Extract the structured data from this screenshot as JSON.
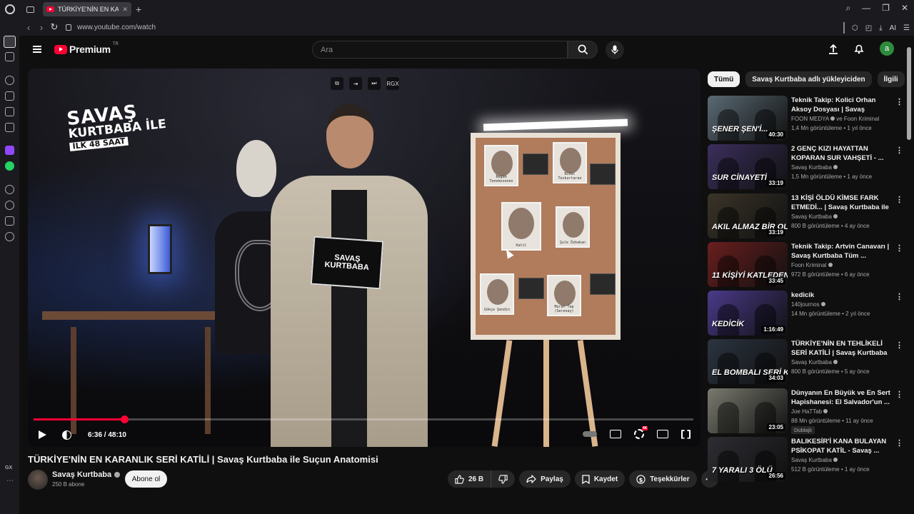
{
  "browser": {
    "tab_title": "TÜRKİYE'NİN EN KARANLIK",
    "url": "www.youtube.com/watch",
    "ai_label": "AI",
    "gx_label": "GX"
  },
  "masthead": {
    "brand": "Premium",
    "tm": "TR",
    "search_placeholder": "Ara",
    "avatar_letter": "a"
  },
  "player": {
    "overlay_logo": {
      "line1": "SAVAŞ",
      "line2": "KURTBABA İLE",
      "line3": "İLK 48 SAAT"
    },
    "card_text": "SAVAŞ KURTBABA",
    "board_labels": [
      "Begüm Tenekesenen",
      "Nihal Teskurtaran",
      "Katil",
      "Şule Özbakan",
      "Gökçe Şendin",
      "Murat Tap (Serenay)"
    ],
    "top_controls": [
      "⧉",
      "⇥",
      "⏭",
      "RGX"
    ],
    "current_time": "6:36",
    "duration": "48:10",
    "progress_fraction": 0.137
  },
  "video": {
    "title": "TÜRKİYE'NİN EN KARANLIK SERİ KATİLİ | Savaş Kurtbaba ile Suçun Anatomisi",
    "channel": "Savaş Kurtbaba",
    "subscribers": "250 B abone",
    "subscribe_label": "Abone ol",
    "likes": "26 B",
    "share_label": "Paylaş",
    "save_label": "Kaydet",
    "thanks_label": "Teşekkürler",
    "more_label": "⋯"
  },
  "chips": [
    "Tümü",
    "Savaş Kurtbaba adlı yükleyiciden",
    "İlgili"
  ],
  "recommendations": [
    {
      "title": "Teknik Takip: Kolici Orhan Aksoy Dosyası | Savaş Kurtba...",
      "channel": "FOON MEDYA",
      "channel_extra": "ve Foon Kriminal",
      "meta": "1,4 Mn görüntüleme • 1 yıl önce",
      "duration": "40:30",
      "thumb_text": "ŞENER ŞEN'İ...",
      "color": "#5a6a74"
    },
    {
      "title": "2 GENÇ KIZI HAYATTAN KOPARAN SUR VAHŞETİ - ...",
      "channel": "Savaş Kurtbaba",
      "channel_extra": "",
      "meta": "1,5 Mn görüntüleme • 1 ay önce",
      "duration": "33:19",
      "thumb_text": "SUR CİNAYETİ",
      "color": "#3b2f5c"
    },
    {
      "title": "13 KİŞİ ÖLDÜ KİMSE FARK ETMEDİ... | Savaş Kurtbaba ile ...",
      "channel": "Savaş Kurtbaba",
      "channel_extra": "",
      "meta": "800 B görüntüleme • 4 ay önce",
      "duration": "33:19",
      "thumb_text": "AKIL ALMAZ BİR OLAY",
      "color": "#3a3428"
    },
    {
      "title": "Teknik Takip: Artvin Canavarı | Savaş Kurtbaba Tüm ...",
      "channel": "Foon Kriminal",
      "channel_extra": "",
      "meta": "972 B görüntüleme • 6 ay önce",
      "duration": "33:45",
      "thumb_text": "11 KİŞİYİ KATLEDEN",
      "color": "#6a1e1e"
    },
    {
      "title": "kedicik",
      "channel": "140journos",
      "channel_extra": "",
      "meta": "14 Mn görüntüleme • 2 yıl önce",
      "duration": "1:16:49",
      "thumb_text": "KEDİCİK",
      "color": "#4b3a8a",
      "single": true
    },
    {
      "title": "TÜRKİYE'NİN EN TEHLİKELİ SERİ KATİLİ | Savaş Kurtbaba i...",
      "channel": "Savaş Kurtbaba",
      "channel_extra": "",
      "meta": "800 B görüntüleme • 5 ay önce",
      "duration": "34:03",
      "thumb_text": "EL BOMBALI SERİ K...",
      "color": "#2b3440"
    },
    {
      "title": "Dünyanın En Büyük ve En Sert Hapishanesi: El Salvador'un ...",
      "channel": "Joe HaTTab",
      "channel_extra": "",
      "meta": "88 Mn görüntüleme • 11 ay önce",
      "duration": "23:05",
      "thumb_text": "",
      "color": "#7a7a70",
      "badge": "Dublajlı"
    },
    {
      "title": "BALIKESİR'İ KANA BULAYAN PSİKOPAT KATİL - Savaş ...",
      "channel": "Savaş Kurtbaba",
      "channel_extra": "",
      "meta": "512 B görüntüleme • 1 ay önce",
      "duration": "26:56",
      "thumb_text": "7 YARALI 3 ÖLÜ",
      "color": "#2d2d33"
    }
  ]
}
